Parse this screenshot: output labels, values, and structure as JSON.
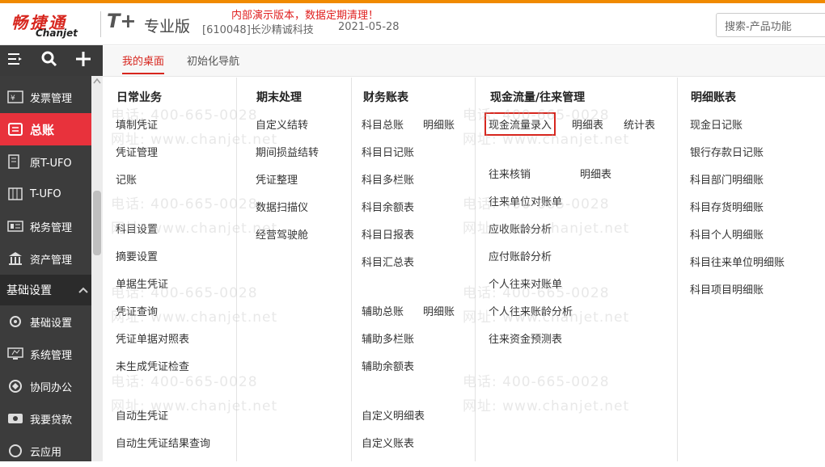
{
  "header": {
    "logo_cn": "畅捷通",
    "logo_en": "Chanjet",
    "product": "T+",
    "edition": "专业版",
    "company": "[610048]长沙精诚科技",
    "date": "2021-05-28",
    "notice": "内部演示版本，数据定期清理！",
    "search_placeholder": "搜索-产品功能"
  },
  "sidebar": {
    "items": [
      {
        "label": "发票管理",
        "icon": "invoice-icon"
      },
      {
        "label": "总账",
        "icon": "ledger-icon"
      },
      {
        "label": "原T-UFO",
        "icon": "ufo-icon"
      },
      {
        "label": "T-UFO",
        "icon": "tufo-icon"
      },
      {
        "label": "税务管理",
        "icon": "tax-icon"
      },
      {
        "label": "资产管理",
        "icon": "asset-icon"
      }
    ],
    "group": "基础设置",
    "group_items": [
      {
        "label": "基础设置",
        "icon": "settings-icon"
      },
      {
        "label": "系统管理",
        "icon": "system-icon"
      },
      {
        "label": "协同办公",
        "icon": "collab-icon"
      },
      {
        "label": "我要贷款",
        "icon": "loan-icon"
      },
      {
        "label": "云应用",
        "icon": "cloud-icon"
      }
    ]
  },
  "tabs": [
    "我的桌面",
    "初始化导航"
  ],
  "columns": {
    "daily": {
      "title": "日常业务",
      "links": [
        "填制凭证",
        "凭证管理",
        "记账",
        "科目设置",
        "摘要设置",
        "单据生凭证",
        "凭证查询",
        "凭证单据对照表",
        "未生成凭证检查",
        "自动生凭证",
        "自动生凭证结果查询"
      ]
    },
    "period": {
      "title": "期末处理",
      "links": [
        "自定义结转",
        "期间损益结转",
        "凭证整理",
        "数据扫描仪",
        "经营驾驶舱"
      ]
    },
    "reports": {
      "title": "财务账表",
      "links": [
        "科目总账",
        "明细账",
        "科目日记账",
        "科目多栏账",
        "科目余额表",
        "科目日报表",
        "科目汇总表",
        "辅助总账",
        "明细账",
        "辅助多栏账",
        "辅助余额表",
        "自定义明细表",
        "自定义账表"
      ]
    },
    "cashflow": {
      "title": "现金流量/往来管理",
      "links": [
        "现金流量录入",
        "明细表",
        "统计表",
        "往来核销",
        "明细表",
        "往来单位对账单",
        "应收账龄分析",
        "应付账龄分析",
        "个人往来对账单",
        "个人往来账龄分析",
        "往来资金预测表"
      ]
    },
    "detail": {
      "title": "明细账表",
      "links": [
        "现金日记账",
        "银行存款日记账",
        "科目部门明细账",
        "科目存货明细账",
        "科目个人明细账",
        "科目往来单位明细账",
        "科目项目明细账"
      ]
    }
  },
  "watermark": {
    "phone": "电话: 400-665-0028",
    "site": "网址: www.chanjet.net"
  }
}
